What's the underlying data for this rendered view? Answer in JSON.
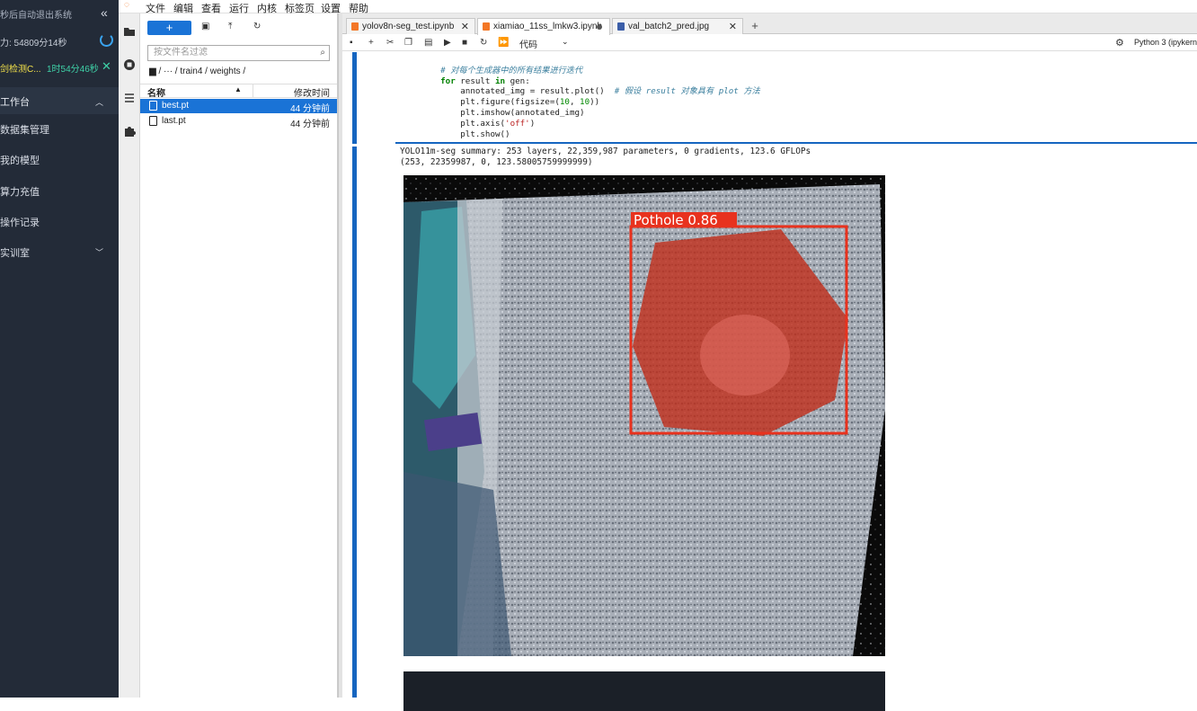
{
  "sidebar": {
    "top_text": "秒后自动退出系统",
    "quota": "力: 54809分14秒",
    "job_name": "剑检测C...",
    "job_time": "1时54分46秒",
    "items": [
      {
        "label": "工作台"
      },
      {
        "label": "数据集管理"
      },
      {
        "label": "我的模型"
      },
      {
        "label": "算力充值"
      },
      {
        "label": "操作记录"
      },
      {
        "label": "实训室"
      }
    ]
  },
  "menu": {
    "items": [
      "文件",
      "编辑",
      "查看",
      "运行",
      "内核",
      "标签页",
      "设置",
      "帮助"
    ]
  },
  "file_browser": {
    "new_label": "+",
    "filter_placeholder": "按文件名过滤",
    "breadcrumb": "/  ···  / train4 / weights /",
    "col_name": "名称",
    "col_modified": "修改时间",
    "files": [
      {
        "name": "best.pt",
        "modified": "44 分钟前",
        "selected": true
      },
      {
        "name": "last.pt",
        "modified": "44 分钟前",
        "selected": false
      }
    ]
  },
  "tabs": [
    {
      "label": "yolov8n-seg_test.ipynb",
      "kind": "notebook"
    },
    {
      "label": "xiamiao_11ss_lmkw3.ipynb",
      "kind": "notebook",
      "active": true
    },
    {
      "label": "val_batch2_pred.jpg",
      "kind": "image"
    }
  ],
  "toolbar": {
    "cell_type": "代码",
    "kernel": "Python 3 (ipykern"
  },
  "code_lines": [
    {
      "cls": "cm",
      "text": "    # 对每个生成器中的所有结果进行迭代"
    },
    {
      "cls": "",
      "text": "    for result in gen:"
    },
    {
      "cls": "",
      "text": "        annotated_img = result.plot()  # 假设 result 对象具有 plot 方法"
    },
    {
      "cls": "",
      "text": "        plt.figure(figsize=(10, 10))"
    },
    {
      "cls": "",
      "text": "        plt.imshow(annotated_img)"
    },
    {
      "cls": "",
      "text": "        plt.axis('off')"
    },
    {
      "cls": "",
      "text": "        plt.show()"
    }
  ],
  "output": {
    "line1": "YOLO11m-seg summary: 253 layers, 22,359,987 parameters, 0 gradients, 123.6 GFLOPs",
    "line2": "(253, 22359987, 0, 123.58005759999999)"
  },
  "detection": {
    "label": "Pothole 0.86",
    "color": "#e8321e"
  }
}
